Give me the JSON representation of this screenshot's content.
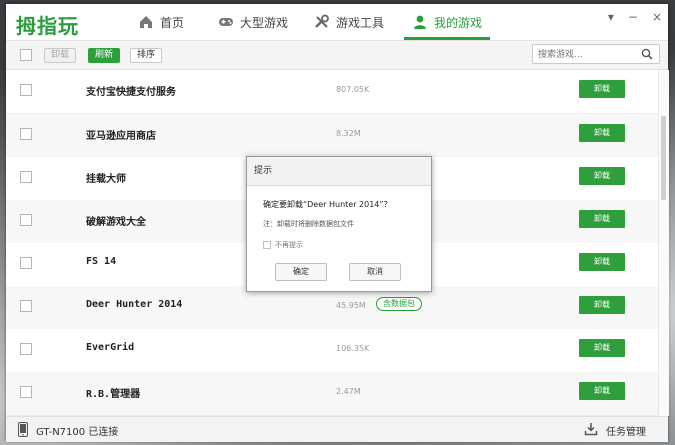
{
  "app": {
    "logo": "拇指玩"
  },
  "nav": [
    {
      "label": "首页",
      "icon": "home-icon"
    },
    {
      "label": "大型游戏",
      "icon": "gamepad-icon"
    },
    {
      "label": "游戏工具",
      "icon": "tools-icon"
    },
    {
      "label": "我的游戏",
      "icon": "user-icon",
      "active": true
    }
  ],
  "window_controls": {
    "menu": "▾",
    "minimize": "−",
    "close": "×"
  },
  "toolbar": {
    "uninstall_label": "卸载",
    "refresh_label": "刷新",
    "sort_label": "排序",
    "search_placeholder": "搜索游戏..."
  },
  "games": [
    {
      "name": "支付宝快捷支付服务",
      "size": "807.05K",
      "action": "卸载"
    },
    {
      "name": "亚马逊应用商店",
      "size": "8.32M",
      "action": "卸载"
    },
    {
      "name": "挂载大师",
      "size": "",
      "action": "卸载"
    },
    {
      "name": "破解游戏大全",
      "size": "",
      "action": "卸载"
    },
    {
      "name": "FS 14",
      "size": "",
      "action": "卸载"
    },
    {
      "name": "Deer Hunter 2014",
      "size": "45.95M",
      "badge": "含数据包",
      "action": "卸载"
    },
    {
      "name": "EverGrid",
      "size": "106.35K",
      "action": "卸载"
    },
    {
      "name": "R.B.管理器",
      "size": "2.47M",
      "action": "卸载"
    }
  ],
  "dialog": {
    "title": "提示",
    "message": "确定要卸载“Deer Hunter 2014”？",
    "note": "注：卸载时将删除数据包文件",
    "checkbox_label": "不再提示",
    "ok_label": "确定",
    "cancel_label": "取消"
  },
  "status": {
    "device": "GT-N7100 已连接",
    "task_manager": "任务管理"
  },
  "colors": {
    "accent": "#2e9f3c"
  }
}
